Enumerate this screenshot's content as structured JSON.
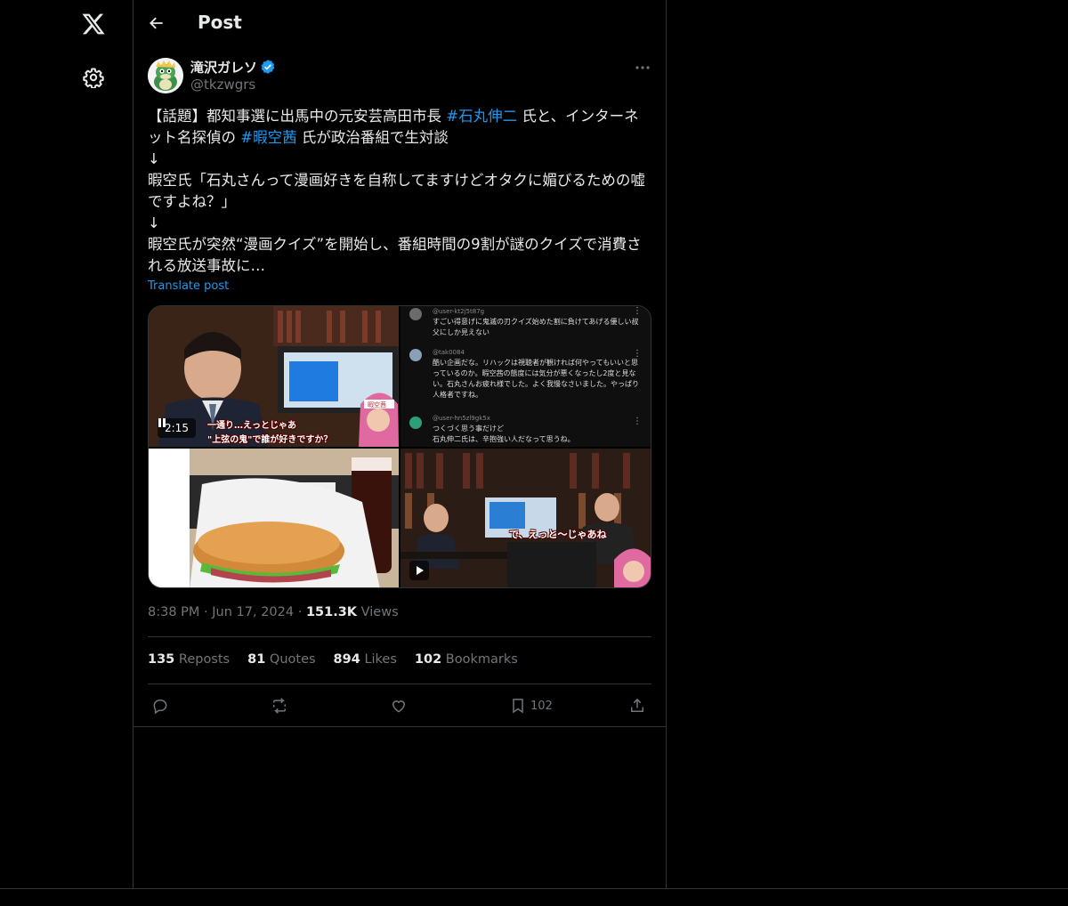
{
  "header": {
    "title": "Post"
  },
  "author": {
    "name": "滝沢ガレソ",
    "handle": "@tkzwgrs",
    "verified": true
  },
  "tweet": {
    "segments": [
      {
        "text": "【話題】都知事選に出馬中の元安芸高田市長 ",
        "hashtag": false
      },
      {
        "text": "#石丸伸二",
        "hashtag": true
      },
      {
        "text": " 氏と、インターネット名探偵の ",
        "hashtag": false
      },
      {
        "text": "#暇空茜",
        "hashtag": true
      },
      {
        "text": " 氏が政治番組で生対談\n↓\n暇空氏「石丸さんって漫画好きを自称してますけどオタクに媚びるための嘘ですよね？」\n↓\n暇空氏が突然“漫画クイズ”を開始し、番組時間の9割が謎のクイズで消費される放送事故に…",
        "hashtag": false
      }
    ],
    "translate_label": "Translate post"
  },
  "media": {
    "video_time": "2:15",
    "caption_lines": [
      "一通り…えっとじゃあ",
      "\"上弦の鬼\"で誰が好きですか？"
    ],
    "name_tag": "暇空茜",
    "comments": [
      {
        "user": "@user-kt2j5t87g",
        "text": "すごい得意げに鬼滅の刃クイズ始めた割に負けてあげる優しい叔父にしか見えない"
      },
      {
        "user": "@tak0084",
        "text": "酷い企画だな。リハックは視聴者が観ければ何やってもいいと思っているのか。暇空茜の態度には気分が悪くなったし2度と見ない。石丸さんお疲れ様でした。よく我慢なさいました。やっぱり人格者ですね。"
      },
      {
        "user": "@user-hn5zl9gk5x",
        "text": "つくづく思う事だけど\n石丸伸二氏は、辛抱強い人だなって思うね。"
      }
    ],
    "caption2": "で、えっと～じゃあね"
  },
  "meta": {
    "time": "8:38 PM",
    "date": "Jun 17, 2024",
    "views_count": "151.3K",
    "views_label": "Views"
  },
  "stats": [
    {
      "count": "135",
      "label": "Reposts"
    },
    {
      "count": "81",
      "label": "Quotes"
    },
    {
      "count": "894",
      "label": "Likes"
    },
    {
      "count": "102",
      "label": "Bookmarks"
    }
  ],
  "actions": {
    "bookmark_count": "102"
  },
  "colors": {
    "accent": "#1d9bf0",
    "muted": "#71767b",
    "text": "#e7e9ea",
    "border": "#2f3336"
  }
}
